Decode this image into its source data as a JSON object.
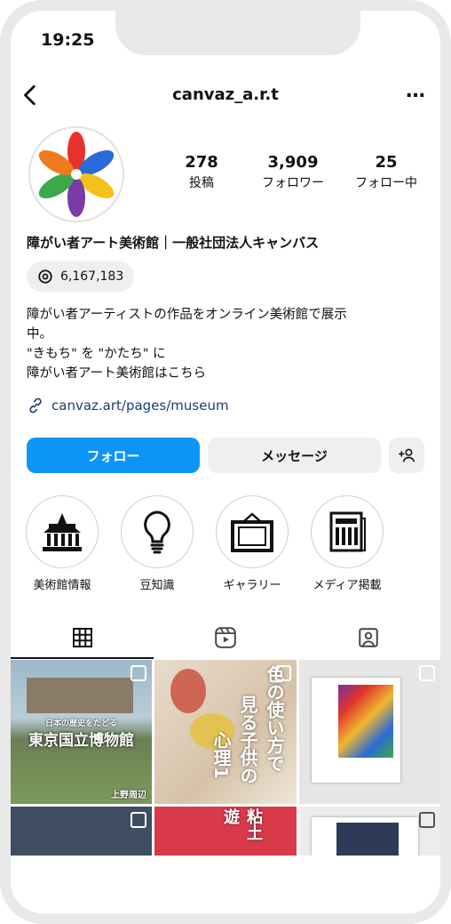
{
  "status": {
    "time": "19:25"
  },
  "header": {
    "username": "canvaz_a.r.t",
    "back_icon": "chevron-left-icon",
    "more_label": "…"
  },
  "stats": [
    {
      "value": "278",
      "label": "投稿"
    },
    {
      "value": "3,909",
      "label": "フォロワー"
    },
    {
      "value": "25",
      "label": "フォロー中"
    }
  ],
  "profile": {
    "name": "障がい者アート美術館｜一般社団法人キャンバス",
    "threads_count": "6,167,183",
    "bio_lines": [
      "障がい者アーティストの作品をオンライン美術館で展示",
      "中。",
      "\"きもち\" を \"かたち\" に",
      "障がい者アート美術館はこちら"
    ],
    "link": "canvaz.art/pages/museum"
  },
  "actions": {
    "follow": "フォロー",
    "message": "メッセージ"
  },
  "highlights": [
    {
      "label": "美術館情報",
      "icon": "museum-icon"
    },
    {
      "label": "豆知識",
      "icon": "lightbulb-icon"
    },
    {
      "label": "ギャラリー",
      "icon": "picture-frame-icon"
    },
    {
      "label": "メディア掲載",
      "icon": "newspaper-icon"
    }
  ],
  "tabs": [
    {
      "name": "posts",
      "icon": "grid-icon"
    },
    {
      "name": "reels",
      "icon": "reels-icon"
    },
    {
      "name": "tagged",
      "icon": "tagged-icon"
    }
  ],
  "posts": {
    "p1": {
      "caption_small": "日本の歴史をたどる",
      "caption_big": "東京国立博物館",
      "caption_corner": "上野周辺"
    },
    "p2": {
      "col1": "色の使い方で",
      "col2": "見る子供の",
      "col3": "心理1"
    },
    "p5": {
      "text": "粘土遊"
    }
  },
  "colors": {
    "accent": "#0c95f6",
    "link": "#1b3d74"
  }
}
